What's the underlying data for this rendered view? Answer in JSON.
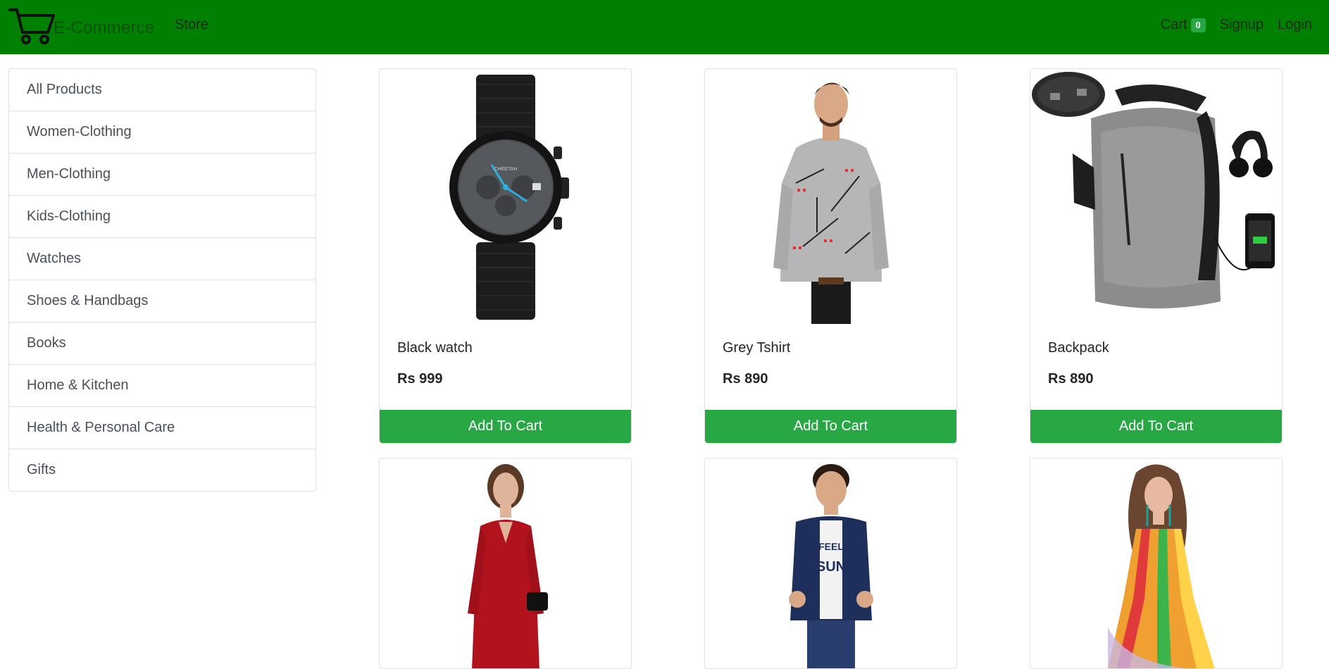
{
  "navbar": {
    "brand": "E-Commerce",
    "brand_icon": "shopping-cart-icon",
    "store_label": "Store",
    "cart_label": "Cart",
    "cart_count": "0",
    "signup_label": "Signup",
    "login_label": "Login",
    "bg_color": "#008000"
  },
  "categories": [
    "All Products",
    "Women-Clothing",
    "Men-Clothing",
    "Kids-Clothing",
    "Watches",
    "Shoes & Handbags",
    "Books",
    "Home & Kitchen",
    "Health & Personal Care",
    "Gifts"
  ],
  "products": [
    {
      "name": "Black watch",
      "price": "Rs 999",
      "button": "Add To Cart",
      "image": "black-watch-image"
    },
    {
      "name": "Grey Tshirt",
      "price": "Rs 890",
      "button": "Add To Cart",
      "image": "grey-hoodie-image"
    },
    {
      "name": "Backpack",
      "price": "Rs 890",
      "button": "Add To Cart",
      "image": "backpack-image"
    },
    {
      "image": "red-dress-image"
    },
    {
      "image": "kids-jacket-image"
    },
    {
      "image": "rainbow-dress-image"
    }
  ],
  "colors": {
    "accent_button": "#28a745",
    "badge": "#28a745"
  }
}
